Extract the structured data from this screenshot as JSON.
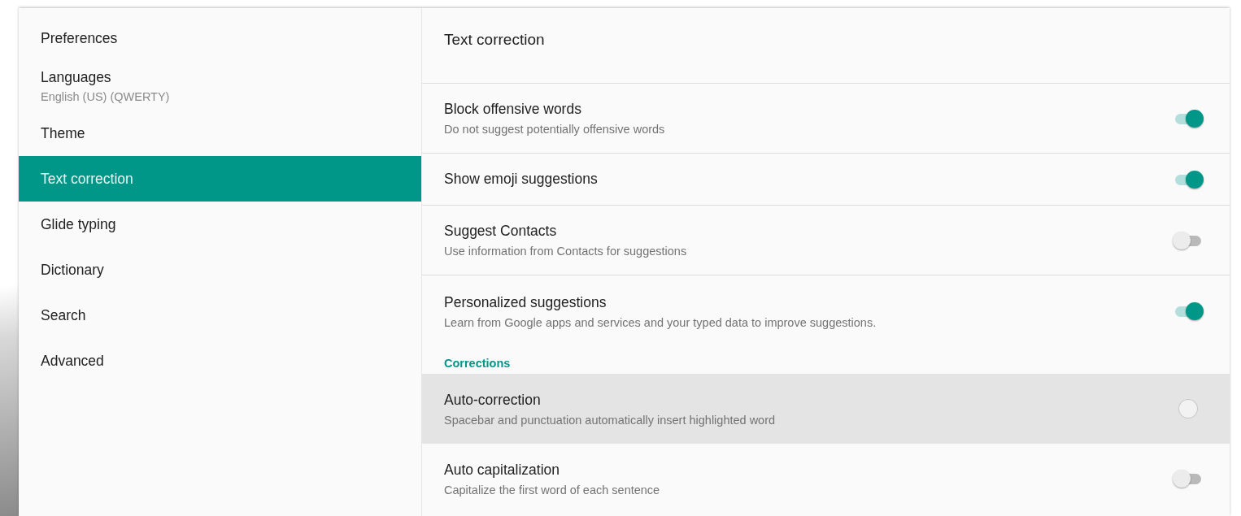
{
  "sidebar": {
    "items": [
      {
        "label": "Preferences",
        "selected": false
      },
      {
        "label": "Languages",
        "subtitle": "English (US) (QWERTY)",
        "selected": false
      },
      {
        "label": "Theme",
        "selected": false
      },
      {
        "label": "Text correction",
        "selected": true
      },
      {
        "label": "Glide typing",
        "selected": false
      },
      {
        "label": "Dictionary",
        "selected": false
      },
      {
        "label": "Search",
        "selected": false
      },
      {
        "label": "Advanced",
        "selected": false
      }
    ]
  },
  "content": {
    "title": "Text correction",
    "sections": [
      {
        "settings": [
          {
            "title": "Block offensive words",
            "summary": "Do not suggest potentially offensive words",
            "on": true,
            "pressed": false
          },
          {
            "title": "Show emoji suggestions",
            "on": true,
            "pressed": false
          },
          {
            "title": "Suggest Contacts",
            "summary": "Use information from Contacts for suggestions",
            "on": false,
            "pressed": false
          },
          {
            "title": "Personalized suggestions",
            "summary": "Learn from Google apps and services and your typed data to improve suggestions.",
            "on": true,
            "pressed": false
          }
        ]
      },
      {
        "header": "Corrections",
        "settings": [
          {
            "title": "Auto-correction",
            "summary": "Spacebar and punctuation automatically insert highlighted word",
            "on": false,
            "pressed": true
          },
          {
            "title": "Auto capitalization",
            "summary": "Capitalize the first word of each sentence",
            "on": false,
            "pressed": false
          }
        ]
      }
    ]
  }
}
